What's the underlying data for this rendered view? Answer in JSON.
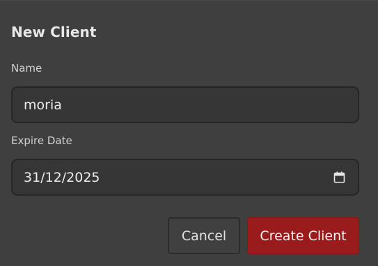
{
  "dialog": {
    "title": "New Client",
    "name_label": "Name",
    "name_value": "moria",
    "expire_label": "Expire Date",
    "expire_value": "31/12/2025",
    "calendar_icon": "calendar-icon",
    "cancel_label": "Cancel",
    "create_label": "Create Client"
  },
  "colors": {
    "accent": "#9a1b1b",
    "background": "#3f3f3f",
    "field_background": "#363636"
  }
}
